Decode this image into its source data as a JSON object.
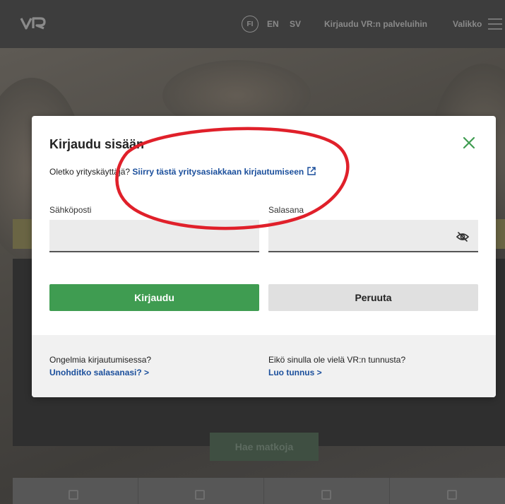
{
  "header": {
    "logo": "VR",
    "languages": [
      "FI",
      "EN",
      "SV"
    ],
    "login_link": "Kirjaudu VR:n palveluihin",
    "menu_label": "Valikko"
  },
  "background": {
    "search_button": "Hae matkoja"
  },
  "modal": {
    "title": "Kirjaudu sisään",
    "corporate_question": "Oletko yrityskäyttäjä?",
    "corporate_link": "Siirry tästä yritysasiakkaan kirjautumiseen",
    "email_label": "Sähköposti",
    "email_value": "",
    "password_label": "Salasana",
    "password_value": "",
    "login_button": "Kirjaudu",
    "cancel_button": "Peruuta",
    "footer": {
      "problem_question": "Ongelmia kirjautumisessa?",
      "forgot_link": "Unohditko salasanasi? >",
      "no_account_question": "Eikö sinulla ole vielä VR:n tunnusta?",
      "create_link": "Luo tunnus >"
    }
  },
  "colors": {
    "accent_green": "#3f9c51",
    "link_blue": "#1b4f9c",
    "annotation_red": "#e0202a",
    "overlay": "#4a4a4a"
  },
  "icons": {
    "close": "close-icon",
    "external_link": "external-link-icon",
    "password_visibility": "eye-off-icon",
    "menu": "hamburger-icon"
  }
}
